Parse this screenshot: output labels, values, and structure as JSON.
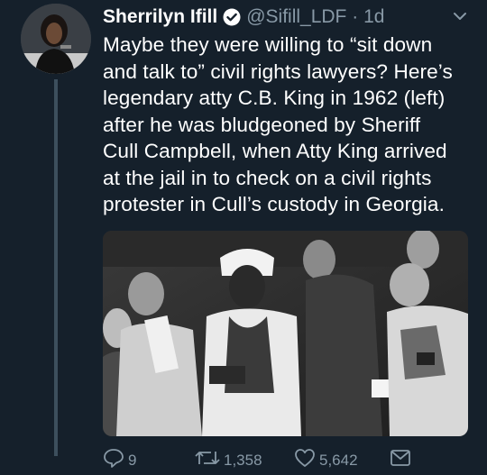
{
  "tweet": {
    "author_name": "Sherrilyn Ifill",
    "handle": "@Sifill_LDF",
    "time": "1d",
    "text": "Maybe they were willing to “sit down\nand talk to” civil rights lawyers? Here’s\nlegendary atty C.B. King in 1962 (left)\nafter he was bludgeoned by Sheriff\nCull Campbell, when Atty King arrived\nat the jail in to check on a civil rights\nprotester in Cull’s custody in Georgia."
  },
  "actions": {
    "replies": "9",
    "retweets": "1,358",
    "likes": "5,642"
  },
  "colors": {
    "background": "#15202b",
    "muted": "#8899a6",
    "verified": "#1da1f2"
  },
  "icons": [
    "verified-badge-icon",
    "chevron-down-icon",
    "reply-icon",
    "retweet-icon",
    "like-icon",
    "share-icon"
  ]
}
